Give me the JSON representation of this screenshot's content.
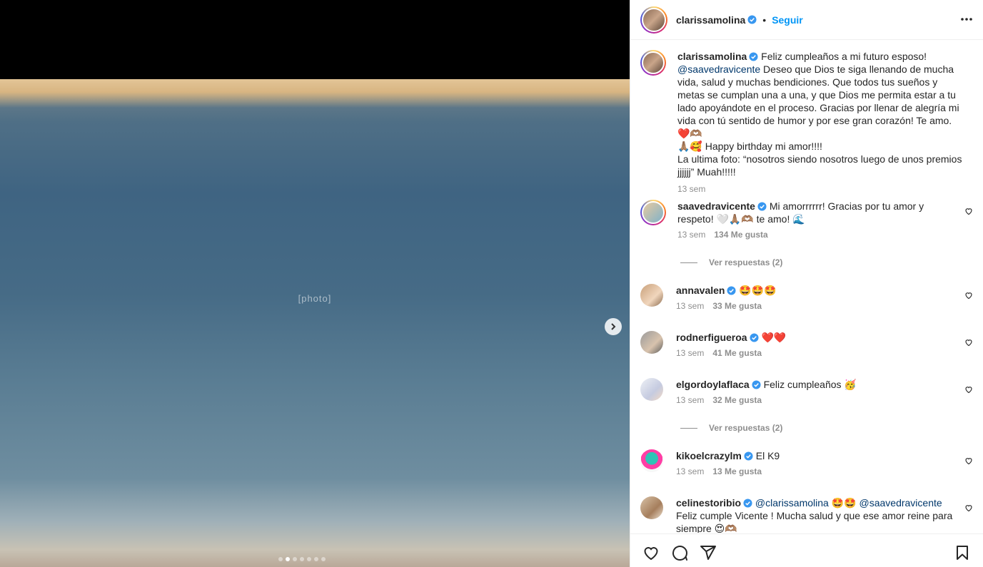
{
  "post": {
    "username": "clarissamolina",
    "follow_label": "Seguir",
    "separator": "•",
    "media_caption": "[photo]",
    "carousel_dots": 7,
    "carousel_active": 1
  },
  "caption": {
    "username": "clarissamolina",
    "text_1": "Feliz cumpleaños a mi futuro esposo!",
    "mention": "@saavedravicente",
    "text_2": " Deseo que Dios te siga llenando de mucha vida, salud y muchas bendiciones. Que todos tus sueños y metas se cumplan una a una, y que Dios me permita estar a tu lado apoyándote en el proceso. Gracias por llenar de alegría mi vida con tú sentido de humor y por ese gran corazón! Te amo. ❤️🫶🏽",
    "text_3": "🙏🏽🥰 Happy birthday mi amor!!!!",
    "text_4": "La ultima foto: “nosotros siendo nosotros luego de unos premios jjjjjj” Muah!!!!!",
    "time": "13 sem"
  },
  "comments": [
    {
      "username": "saavedravicente",
      "text": "Mi amorrrrrr! Gracias por tu amor y respeto! 🤍🙏🏽🫶🏽 te amo! 🌊",
      "time": "13 sem",
      "likes": "134 Me gusta",
      "verified": true
    },
    {
      "username": "annavalen",
      "text": "🤩🤩🤩",
      "time": "13 sem",
      "likes": "33 Me gusta",
      "verified": true
    },
    {
      "username": "rodnerfigueroa",
      "text": "❤️❤️",
      "time": "13 sem",
      "likes": "41 Me gusta",
      "verified": true
    },
    {
      "username": "elgordoylaflaca",
      "text": "Feliz cumpleaños 🥳",
      "time": "13 sem",
      "likes": "32 Me gusta",
      "verified": true
    },
    {
      "username": "kikoelcrazylm",
      "text": "El K9",
      "time": "13 sem",
      "likes": "13 Me gusta",
      "verified": true
    },
    {
      "username": "celinestoribio",
      "mention_1": "@clarissamolina",
      "emoji": " 🤩🤩 ",
      "mention_2": "@saavedravicente",
      "text": "Feliz cumple Vicente ! Mucha salud y que ese amor reine para siempre 😍🫶🏽",
      "verified": true
    }
  ],
  "replies": [
    {
      "label": "Ver respuestas (2)"
    },
    {
      "label": "Ver respuestas (2)"
    }
  ],
  "colors": {
    "accent": "#0095f6",
    "verified": "#3897f0",
    "meta": "#8e8e8e",
    "mention": "#00376b"
  },
  "icons": [
    "verified-icon",
    "more-icon",
    "heart-icon",
    "comment-icon",
    "share-icon",
    "bookmark-icon",
    "chevron-right-icon"
  ]
}
